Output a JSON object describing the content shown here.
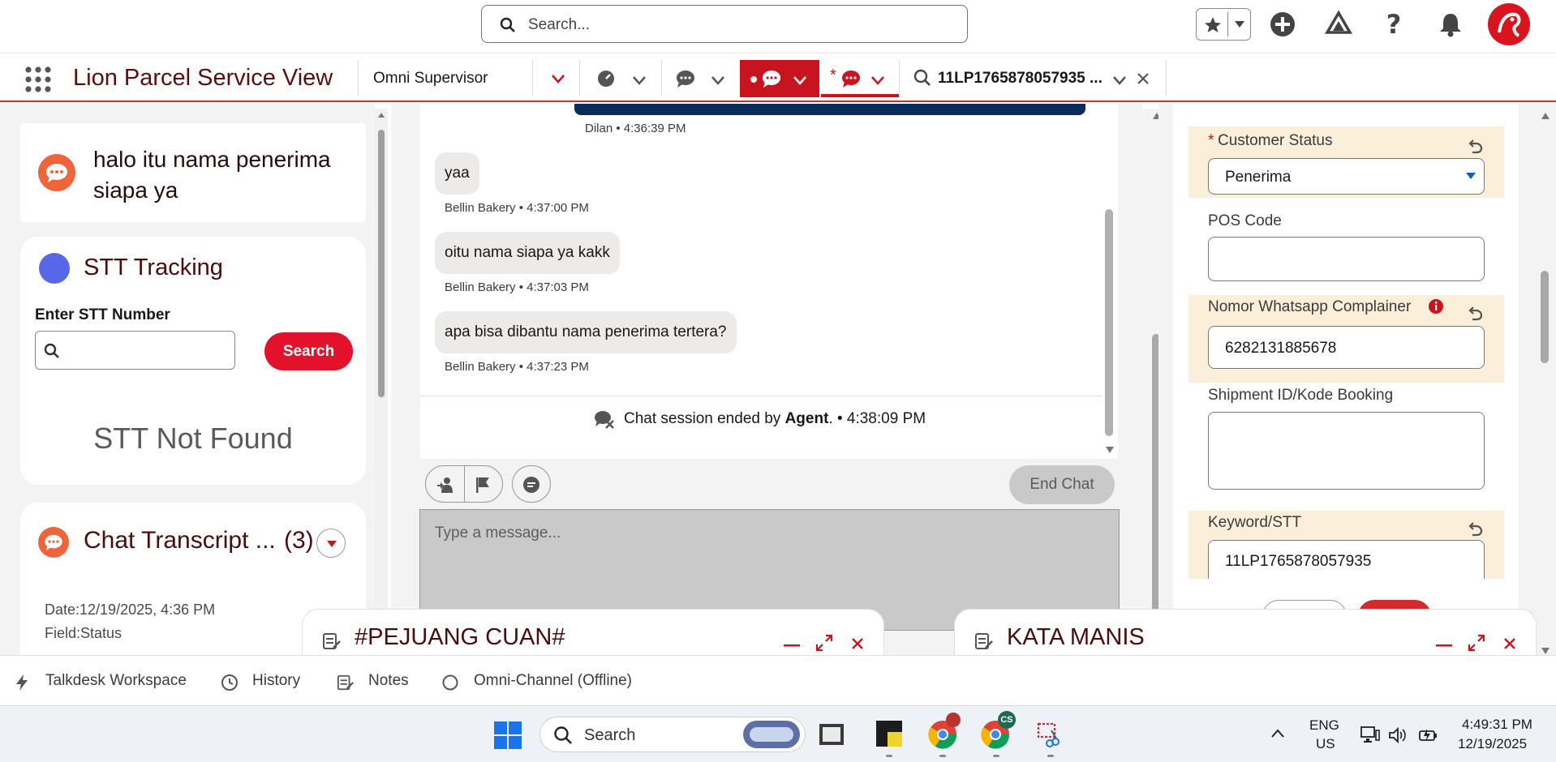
{
  "header": {
    "search_placeholder": "Search..."
  },
  "nav": {
    "app_title": "Lion Parcel Service View",
    "omni_label": "Omni Supervisor",
    "record_tab": "11LP1765878057935 ...",
    "tab_active_marker": "*"
  },
  "left": {
    "hero_message": "halo itu nama penerima siapa ya",
    "stt": {
      "title": "STT Tracking",
      "input_label": "Enter STT Number",
      "search_button": "Search",
      "not_found": "STT Not Found"
    },
    "chat_transcript": {
      "title": "Chat Transcript ...",
      "count": "(3)",
      "date": "Date:12/19/2025, 4:36 PM",
      "field": "Field:Status"
    }
  },
  "chat": {
    "top_meta": "Dilan • 4:36:39 PM",
    "messages": [
      {
        "text": "yaa",
        "meta": "Bellin Bakery • 4:37:00 PM"
      },
      {
        "text": "oitu nama siapa ya kakk",
        "meta": "Bellin Bakery • 4:37:03 PM"
      },
      {
        "text": "apa bisa dibantu nama penerima tertera?",
        "meta": "Bellin Bakery • 4:37:23 PM"
      }
    ],
    "ended_prefix": "Chat session ended by ",
    "ended_actor": "Agent",
    "ended_suffix": ". • 4:38:09 PM",
    "end_chat_button": "End Chat",
    "input_placeholder": "Type a message..."
  },
  "form": {
    "customer_status_label": "Customer Status",
    "customer_status_value": "Penerima",
    "pos_code_label": "POS Code",
    "pos_code_value": "",
    "whatsapp_label": "Nomor Whatsapp Complainer",
    "whatsapp_value": "6282131885678",
    "shipment_label": "Shipment ID/Kode Booking",
    "shipment_value": "",
    "keyword_label": "Keyword/STT",
    "keyword_value": "11LP1765878057935",
    "required_marker": "*"
  },
  "floating": {
    "win1": "#PEJUANG CUAN#",
    "win2": "KATA MANIS"
  },
  "utility": {
    "talkdesk": "Talkdesk Workspace",
    "history": "History",
    "notes": "Notes",
    "omni": "Omni-Channel (Offline)"
  },
  "taskbar": {
    "search_placeholder": "Search",
    "lang_line1": "ENG",
    "lang_line2": "US",
    "time": "4:49:31 PM",
    "date": "12/19/2025",
    "chrome_badge": "CS"
  },
  "colors": {
    "brand_red": "#c9141f",
    "title_maroon": "#5c0e0e",
    "highlight": "#fbefd9",
    "chat_orange": "#f0643c",
    "stt_dot": "#5867e8"
  }
}
